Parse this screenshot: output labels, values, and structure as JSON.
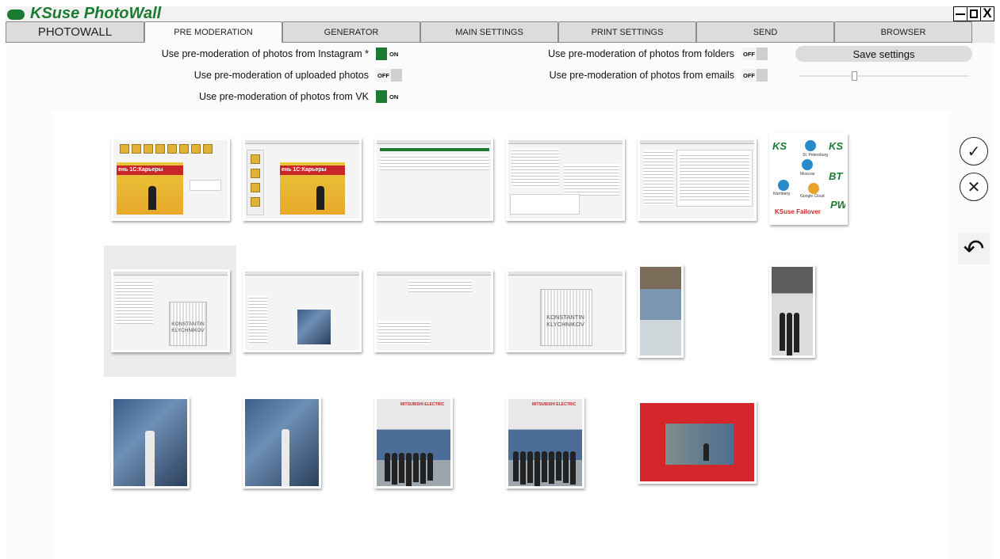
{
  "window": {
    "title": "KSuse PhotoWall",
    "controls": {
      "minimize": "–",
      "maximize": "□",
      "close": "X"
    }
  },
  "tabs": [
    {
      "label": "PHOTOWALL",
      "active": false
    },
    {
      "label": "PRE MODERATION",
      "active": true
    },
    {
      "label": "GENERATOR",
      "active": false
    },
    {
      "label": "MAIN SETTINGS",
      "active": false
    },
    {
      "label": "PRINT SETTINGS",
      "active": false
    },
    {
      "label": "SEND",
      "active": false
    },
    {
      "label": "BROWSER",
      "active": false
    }
  ],
  "settings": {
    "instagram": {
      "label": "Use pre-moderation of photos from Instagram *",
      "state": "ON"
    },
    "uploaded": {
      "label": "Use pre-moderation of uploaded photos",
      "state": "OFF"
    },
    "vk": {
      "label": "Use pre-moderation of photos from VK",
      "state": "ON"
    },
    "folders": {
      "label": "Use pre-moderation of photos from folders",
      "state": "OFF"
    },
    "emails": {
      "label": "Use pre-moderation of photos from emails",
      "state": "OFF"
    },
    "save_label": "Save settings",
    "slider_level": 0.32
  },
  "thumbnails": {
    "stage_banner": "ень 1С:Карьеры",
    "qr_caption_1": "KONSTANTIN\nKLYCHNIKOV",
    "qr_caption_2": "KONSTANTIN\nKLYCHNIKOV",
    "failover": {
      "logo_left": "KS",
      "logo_right": "KS",
      "logo_bt": "BT",
      "logo_pw": "PW",
      "node_1": "St. Petersburg",
      "node_2": "Moscow",
      "node_3": "Nürnberg",
      "node_4": "Google Cloud",
      "caption": "KSuse Failover"
    },
    "expo_brand": "MITSUBISHI ELECTRIC"
  },
  "actions": {
    "approve_icon": "check-circle-icon",
    "reject_icon": "x-circle-icon",
    "undo_icon": "undo-arrow-icon"
  },
  "colors": {
    "brand_green": "#1d7a32",
    "toggle_on": "#1d7a32",
    "toggle_off": "#cfcfcf",
    "tab_bg": "#dcdcdc"
  }
}
